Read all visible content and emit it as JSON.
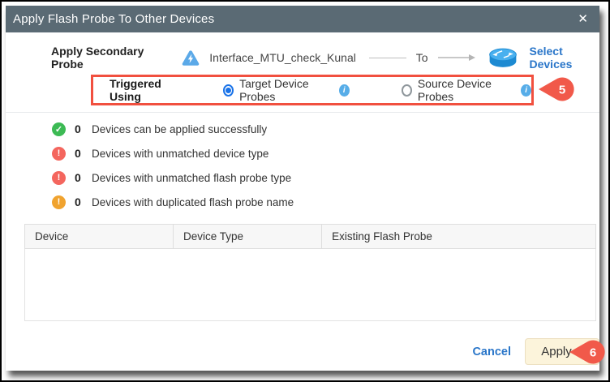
{
  "window": {
    "title": "Apply Flash Probe To Other Devices",
    "close_glyph": "✕"
  },
  "probe_row": {
    "label": "Apply Secondary Probe",
    "probe_name": "Interface_MTU_check_Kunal",
    "to_label": "To",
    "select_devices_label": "Select Devices"
  },
  "triggered": {
    "label": "Triggered Using",
    "options": [
      {
        "label": "Target Device Probes",
        "selected": true,
        "info_glyph": "i"
      },
      {
        "label": "Source Device Probes",
        "selected": false,
        "info_glyph": "i"
      }
    ],
    "callout_number": "5"
  },
  "status_rows": [
    {
      "icon": "success-icon",
      "glyph": "✓",
      "count": "0",
      "text": "Devices can be applied successfully"
    },
    {
      "icon": "error-icon",
      "glyph": "!",
      "count": "0",
      "text": "Devices with unmatched device type"
    },
    {
      "icon": "error-icon",
      "glyph": "!",
      "count": "0",
      "text": "Devices with unmatched flash probe type"
    },
    {
      "icon": "warning-icon",
      "glyph": "!",
      "count": "0",
      "text": "Devices with duplicated flash probe name"
    }
  ],
  "table": {
    "columns": [
      "Device",
      "Device Type",
      "Existing Flash Probe"
    ],
    "rows": []
  },
  "footer": {
    "cancel_label": "Cancel",
    "apply_label": "Apply",
    "callout_number": "6"
  },
  "colors": {
    "titlebar": "#5a6a74",
    "accent_blue": "#2a76c9",
    "radio_blue": "#1a73e8",
    "callout_red": "#f1594a",
    "red_border": "#f1503f",
    "success_green": "#3cba54",
    "error_red": "#f4665e",
    "warning_orange": "#f0a32f",
    "apply_button_bg": "#fcf4db"
  }
}
